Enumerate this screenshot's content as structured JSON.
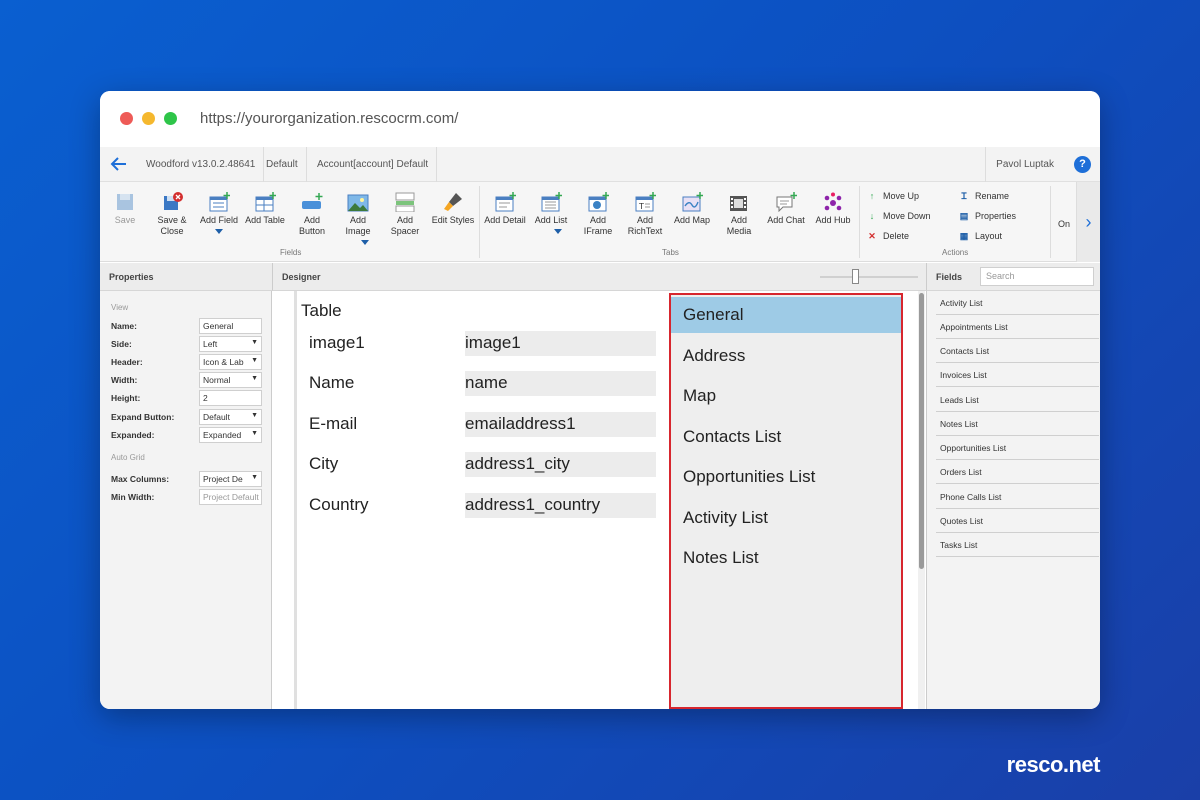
{
  "browser": {
    "url": "https://yourorganization.rescocrm.com/"
  },
  "appbar": {
    "version": "Woodford v13.0.2.48641",
    "project": "Default",
    "form": "Account[account] Default",
    "user": "Pavol Luptak",
    "help": "?"
  },
  "ribbon": {
    "save": "Save",
    "save_close": "Save &\nClose",
    "add_field": "Add Field",
    "add_table": "Add Table",
    "add_button": "Add\nButton",
    "add_image": "Add\nImage",
    "add_spacer": "Add\nSpacer",
    "edit_styles": "Edit Styles",
    "add_detail": "Add Detail",
    "add_list": "Add List",
    "add_iframe": "Add\nIFrame",
    "add_richtext": "Add\nRichText",
    "add_map": "Add Map",
    "add_media": "Add\nMedia",
    "add_chat": "Add Chat",
    "add_hub": "Add Hub",
    "move_up": "Move Up",
    "move_down": "Move Down",
    "delete": "Delete",
    "rename": "Rename",
    "properties": "Properties",
    "layout": "Layout",
    "on": "On",
    "group_fields": "Fields",
    "group_tabs": "Tabs",
    "group_actions": "Actions"
  },
  "panels": {
    "properties_title": "Properties",
    "designer_title": "Designer",
    "fields_title": "Fields",
    "search_placeholder": "Search"
  },
  "properties": {
    "view_section": "View",
    "auto_grid_section": "Auto Grid",
    "name_label": "Name:",
    "name_value": "General",
    "side_label": "Side:",
    "side_value": "Left",
    "header_label": "Header:",
    "header_value": "Icon & Lab",
    "width_label": "Width:",
    "width_value": "Normal",
    "height_label": "Height:",
    "height_value": "2",
    "expand_label": "Expand Button:",
    "expand_value": "Default",
    "expanded_label": "Expanded:",
    "expanded_value": "Expanded",
    "maxcol_label": "Max Columns:",
    "maxcol_value": "Project De",
    "minwidth_label": "Min Width:",
    "minwidth_placeholder": "Project Default"
  },
  "designer": {
    "table_title": "Table",
    "rows": [
      {
        "label": "image1",
        "value": "image1"
      },
      {
        "label": "Name",
        "value": "name"
      },
      {
        "label": "E-mail",
        "value": "emailaddress1"
      },
      {
        "label": "City",
        "value": "address1_city"
      },
      {
        "label": "Country",
        "value": "address1_country"
      }
    ],
    "tabs": [
      "General",
      "Address",
      "Map",
      "Contacts List",
      "Opportunities List",
      "Activity List",
      "Notes List"
    ],
    "zoom_level": 0.35
  },
  "fields": [
    "Activity List",
    "Appointments List",
    "Contacts List",
    "Invoices List",
    "Leads List",
    "Notes List",
    "Opportunities List",
    "Orders List",
    "Phone Calls List",
    "Quotes List",
    "Tasks List"
  ],
  "brand": "resco.net",
  "colors": {
    "accent": "#1e6fd8",
    "selected_tab": "#9ecbe6",
    "highlight_border": "#d7262e"
  }
}
